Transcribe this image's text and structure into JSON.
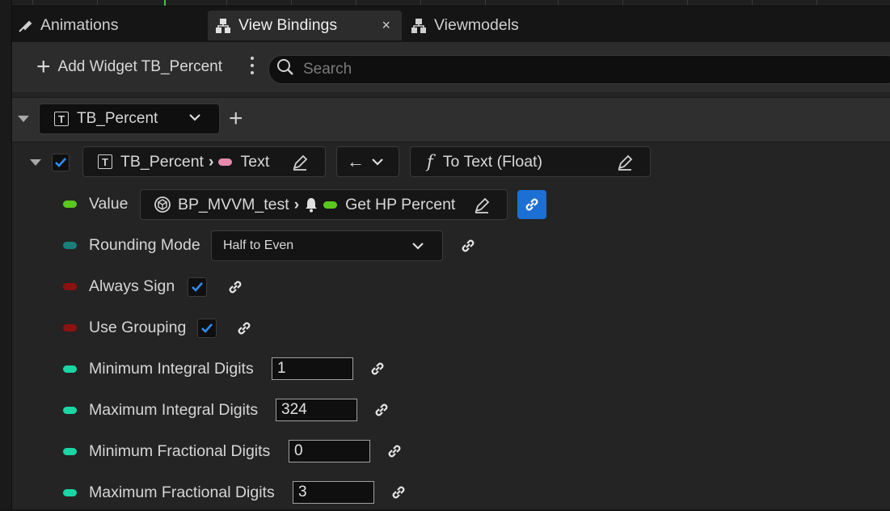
{
  "tabs": [
    {
      "label": "Animations",
      "icon": "animation-icon"
    },
    {
      "label": "View Bindings",
      "icon": "bindings-icon",
      "active": true,
      "close": "×"
    },
    {
      "label": "Viewmodels",
      "icon": "viewmodels-icon"
    }
  ],
  "toolbar": {
    "add_label": "Add Widget TB_Percent",
    "search_placeholder": "Search"
  },
  "group": {
    "widget": "TB_Percent"
  },
  "binding": {
    "checked": true,
    "widget": "TB_Percent",
    "property": "Text",
    "direction": "←",
    "conversion_glyph": "f",
    "conversion": "To Text (Float)"
  },
  "props": [
    {
      "label": "Value",
      "color": "#5ac81e",
      "source": "BP_MVVM_test",
      "source_prop": "Get HP Percent"
    },
    {
      "label": "Rounding Mode",
      "color": "#1a7f7a",
      "value": "Half to Even"
    },
    {
      "label": "Always Sign",
      "color": "#8c1212",
      "checked": true
    },
    {
      "label": "Use Grouping",
      "color": "#8c1212",
      "checked": true
    },
    {
      "label": "Minimum Integral Digits",
      "color": "#1ad6a5",
      "value": "1"
    },
    {
      "label": "Maximum Integral Digits",
      "color": "#1ad6a5",
      "value": "324"
    },
    {
      "label": "Minimum Fractional Digits",
      "color": "#1ad6a5",
      "value": "0"
    },
    {
      "label": "Maximum Fractional Digits",
      "color": "#1ad6a5",
      "value": "3"
    }
  ],
  "colors": {
    "accent": "#1c6fd3",
    "pink": "#e68aac",
    "green": "#3ec83e"
  }
}
